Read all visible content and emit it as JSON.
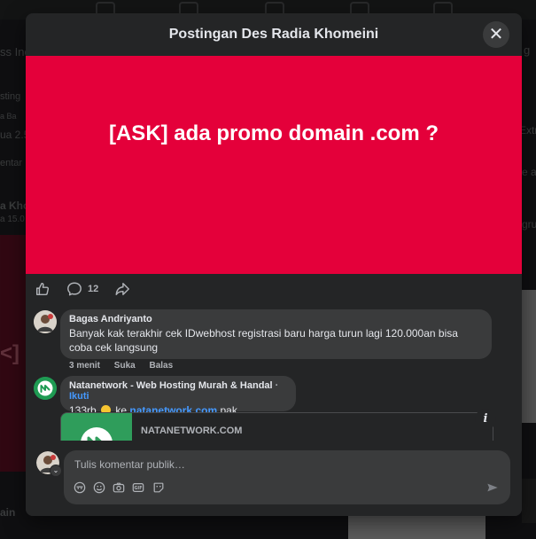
{
  "background": {
    "left_texts": [
      "ss Inc",
      "sting",
      "a   Ba",
      "ua 2.5",
      "entar",
      "a Kho",
      "a 15.0",
      "<] a",
      "ain"
    ],
    "right_texts": [
      "g",
      "Extr",
      "e ar",
      "grup"
    ]
  },
  "modal": {
    "title": "Postingan Des Radia Khomeini",
    "close_label": "✕"
  },
  "post": {
    "banner_text": "[ASK] ada promo domain .com ?",
    "banner_color": "#e4003a",
    "comment_count": "12"
  },
  "comments": [
    {
      "author": "Bagas Andriyanto",
      "text": "Banyak kak terakhir cek IDwebhost registrasi baru harga turun lagi 120.000an bisa coba cek langsung",
      "time": "3 menit",
      "like": "Suka",
      "reply": "Balas"
    },
    {
      "author": "Natanetwork - Web Hosting Murah & Handal",
      "follow_sep": "·",
      "follow": "Ikuti",
      "text_prefix": "133rb",
      "text_mid": "ke",
      "link": "natanetwork.com",
      "text_suffix": "pak",
      "card_domain": "NATANETWORK.COM"
    }
  ],
  "composer": {
    "placeholder": "Tulis komentar publik…"
  },
  "icons": {
    "like": "thumbs-up-icon",
    "comment": "comment-bubble-icon",
    "share": "share-arrow-icon",
    "avatar_sticker": "avatar-sticker-icon",
    "emoji": "emoji-icon",
    "camera": "camera-icon",
    "gif": "gif-icon",
    "sticker": "sticker-icon",
    "send": "send-icon",
    "info": "info-icon"
  }
}
